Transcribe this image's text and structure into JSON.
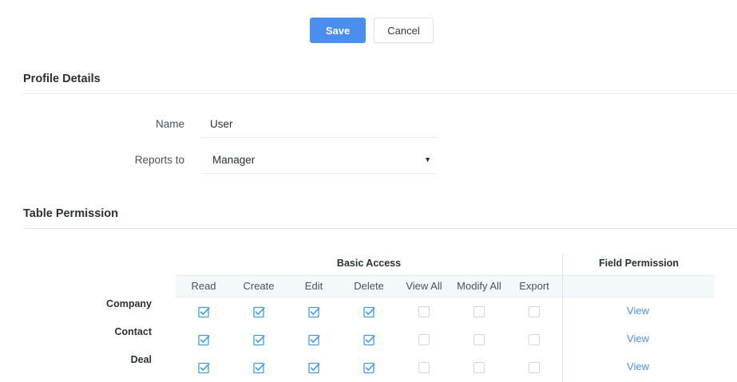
{
  "toolbar": {
    "save_label": "Save",
    "cancel_label": "Cancel"
  },
  "profile": {
    "title": "Profile Details",
    "name_label": "Name",
    "name_value": "User",
    "reports_label": "Reports to",
    "reports_value": "Manager"
  },
  "permissions": {
    "title": "Table Permission",
    "basic_access_header": "Basic Access",
    "field_permission_header": "Field Permission",
    "columns": [
      "Read",
      "Create",
      "Edit",
      "Delete",
      "View All",
      "Modify All",
      "Export"
    ],
    "rows": [
      {
        "label": "Company",
        "checks": [
          true,
          true,
          true,
          true,
          false,
          false,
          false
        ],
        "field_link": "View"
      },
      {
        "label": "Contact",
        "checks": [
          true,
          true,
          true,
          true,
          false,
          false,
          false
        ],
        "field_link": "View"
      },
      {
        "label": "Deal",
        "checks": [
          true,
          true,
          true,
          true,
          false,
          false,
          false
        ],
        "field_link": "View"
      }
    ]
  },
  "colors": {
    "accent": "#4a8ff0",
    "checkbox": "#3d9be9",
    "text": "#263238",
    "divider": "#e4e8ec"
  }
}
